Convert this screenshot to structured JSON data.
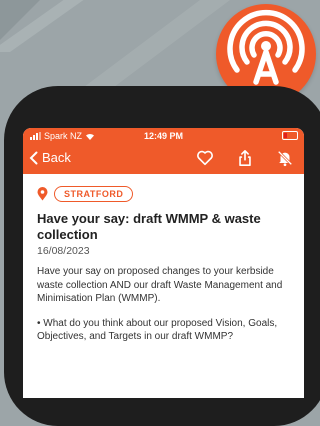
{
  "statusbar": {
    "carrier": "Spark NZ",
    "time": "12:49 PM"
  },
  "navbar": {
    "back_label": "Back"
  },
  "article": {
    "location_tag": "STRATFORD",
    "title": "Have your say: draft WMMP & waste collection",
    "date": "16/08/2023",
    "paragraphs": [
      "Have your say on proposed changes to your kerbside waste collection AND our draft Waste Management and Minimisation Plan (WMMP).",
      "• What do you think about our proposed Vision, Goals, Objectives, and Targets in our draft WMMP?"
    ]
  },
  "colors": {
    "accent": "#ef5a2a",
    "background": "#9ca5a8",
    "phone": "#1e1e1e"
  },
  "icons": [
    "antenna-logo-icon",
    "signal-icon",
    "wifi-icon",
    "battery-icon",
    "chevron-left-icon",
    "heart-icon",
    "share-icon",
    "bell-off-icon",
    "location-pin-icon"
  ]
}
